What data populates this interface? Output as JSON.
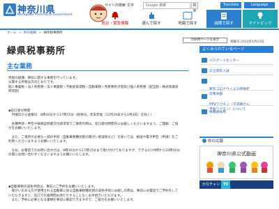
{
  "header": {
    "logo_title": "神奈川県",
    "logo_sub": "Kanagawa Prefectural Government",
    "util_links": [
      "サイト内検索",
      "文字"
    ],
    "search_placeholder": "Google 検索",
    "search_button": "検索",
    "translate_label": "Translate",
    "language_label": "Language",
    "nav": [
      {
        "label": "防災・緊急情報",
        "icon": "bell-icon"
      },
      {
        "label": "選んで探す",
        "icon": "hand-icon"
      },
      {
        "label": "地図で探す",
        "icon": "map-icon"
      },
      {
        "label": "組織で探す",
        "icon": "building-icon"
      },
      {
        "label": "マイトピック",
        "icon": "bulb-icon"
      }
    ]
  },
  "breadcrumb": {
    "items": [
      "ホーム",
      "県の組織",
      "緑県税事務所"
    ],
    "separator": ">"
  },
  "page": {
    "title": "緑県税事務所",
    "print_label": "印刷用ページを表示",
    "date": "掲載日:2024年6月25日",
    "section_heading": "主な業務"
  },
  "content": {
    "block1": [
      "県税の賦課、徴収に関する事務を行っています。",
      "分掌する県税は次のとおりです。",
      "個人事業税・法人県民税・法人事業税・不動産取得税・自動車税・県民税利子割及び個人県民税（配当割・株式等譲渡",
      "所得割）"
    ],
    "block2": [
      "◆窓口受付時間",
      "　月曜日から金曜日　8時30分から17時15分（祝休日、年末年始（12月29日から1月3日）を除く）",
      "",
      "　各種申請・申告や納税証明書交付請求等でご来所の際は、窓口受付時間内にお越しくださいますよう、ご理解、ご協",
      "力をお願いいたします。",
      "",
      "　また、ご来所が必要な一部の手続（自動車税種別割の障がい者減免など）を除いては、郵送や電子申告（申請）をご",
      "利用くださいますようお願いいたします。",
      "",
      "　なお、お電話でのお問い合わせは、8時30分から17時15分まで受け付けておりますが、できるだけ9時から16時30分",
      "の間にお問い合わせくださいますようお願いいたします。"
    ],
    "block3": [
      "◆自動車税の減免手続は、事前にご予約をお願いいたします。",
      "　障がいのある方が使用される自動車に係る自動車税種別割の減免手続にお越しの際は、事前にお電話でご予約をして",
      "いただきますと、窓口での長時間お待たせすることなくお手続きいただけます。",
      "　また、予約に必要となる書類を事前に確認できますので、ご協力をお願いいたします。"
    ]
  },
  "sidebar": {
    "heading": "よくみられているページ",
    "items": [
      "パスポートセンター",
      "公立高校入試",
      "新型コロナウイルス感染症\n対策本部",
      "HPVワクチン（子宮頸がん\n予防ワクチン）について",
      "県職員採用"
    ],
    "section2": "県の広報",
    "promo_title": "神奈川県公式動画",
    "kanachan_label": "かなチャン",
    "kanachan_tv": "TV"
  },
  "colors": {
    "brand_blue": "#2a7fd0",
    "link_blue": "#2a5db0",
    "teal": "#1fa6b5",
    "alert_red": "#cc0000"
  }
}
